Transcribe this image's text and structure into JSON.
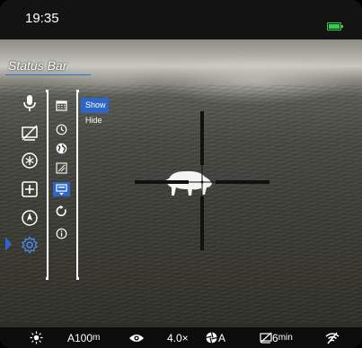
{
  "status_bar": {
    "time": "19:35",
    "battery_icon": "battery-full-icon",
    "battery_color": "#2fd14b"
  },
  "menu": {
    "title": "Status Bar",
    "accent_color": "#2c67c8",
    "main_items": [
      {
        "icon": "microphone-icon"
      },
      {
        "icon": "display-off-icon"
      },
      {
        "icon": "snowflake-mode-icon"
      },
      {
        "icon": "plus-box-icon"
      },
      {
        "icon": "compass-icon"
      },
      {
        "icon": "settings-gear-icon",
        "selected": true
      }
    ],
    "sub_items": [
      {
        "icon": "calendar-icon"
      },
      {
        "icon": "clock-icon"
      },
      {
        "icon": "globe-language-icon"
      },
      {
        "icon": "compass-calibration-icon"
      },
      {
        "icon": "status-bar-icon",
        "selected": true
      },
      {
        "icon": "reset-icon"
      },
      {
        "icon": "info-icon"
      }
    ],
    "options": [
      {
        "label": "Show",
        "selected": true
      },
      {
        "label": "Hide",
        "selected": false
      }
    ]
  },
  "bottom_bar": {
    "brightness_icon": "brightness-sun-icon",
    "range": "A100",
    "range_unit": "m",
    "eye_icon": "eye-icon",
    "zoom": "4.0×",
    "calibration_icon": "aperture-calibration-icon",
    "calibration_mode": "A",
    "display_off_icon": "display-off-icon",
    "display_off_time": "6",
    "display_off_unit": "min",
    "wifi_icon": "wifi-off-icon"
  }
}
